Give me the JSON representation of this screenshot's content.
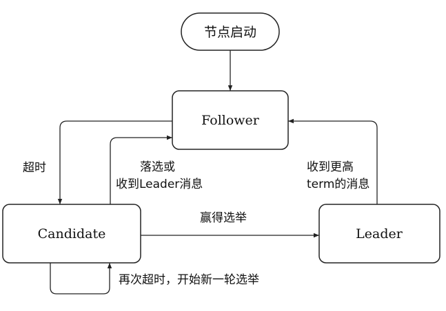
{
  "nodes": {
    "start": "节点启动",
    "follower": "Follower",
    "candidate": "Candidate",
    "leader": "Leader"
  },
  "edges": {
    "timeout": "超时",
    "lose_line1": "落选或",
    "lose_line2": "收到Leader消息",
    "win": "赢得选举",
    "higher_term_line1": "收到更高",
    "higher_term_line2": "term的消息",
    "retimeout": "再次超时，开始新一轮选举"
  },
  "colors": {
    "stroke": "#222222",
    "background": "#ffffff",
    "text": "#111111"
  }
}
